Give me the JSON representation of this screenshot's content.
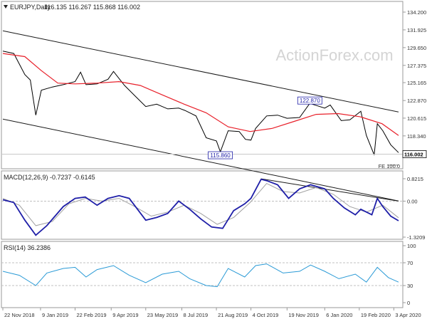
{
  "chart_data": {
    "type": "line",
    "panels": [
      {
        "id": "price",
        "header": {
          "symbol": "EURJPY,Daily",
          "ohlc": "116.135 116.267 115.868 116.002"
        },
        "yticks": [
          "134.200",
          "131.925",
          "129.650",
          "127.375",
          "125.165",
          "122.870",
          "120.615",
          "118.340",
          "116.065",
          "113.855"
        ],
        "ylim": [
          113.855,
          134.2
        ],
        "current_price": "116.002",
        "watermark": "ActionForex.com",
        "annotations": [
          {
            "text": "122.870",
            "x": "2019-12-18",
            "y": 122.87
          },
          {
            "text": "115.860",
            "x": "2019-08-26",
            "y": 115.86
          },
          {
            "text": "FE 100.0",
            "x": "2020-03-28",
            "y": 114.5
          }
        ],
        "series": [
          {
            "color": "#000000",
            "points": [
              [
                "2018-11-22",
                129.2
              ],
              [
                "2018-12-06",
                128.9
              ],
              [
                "2018-12-20",
                126.2
              ],
              [
                "2018-12-27",
                125.5
              ],
              [
                "2019-01-03",
                121.0
              ],
              [
                "2019-01-10",
                124.2
              ],
              [
                "2019-01-24",
                124.6
              ],
              [
                "2019-02-07",
                124.9
              ],
              [
                "2019-02-22",
                125.3
              ],
              [
                "2019-03-01",
                126.5
              ],
              [
                "2019-03-08",
                124.9
              ],
              [
                "2019-03-22",
                125.0
              ],
              [
                "2019-04-05",
                125.6
              ],
              [
                "2019-04-12",
                126.6
              ],
              [
                "2019-04-26",
                124.8
              ],
              [
                "2019-05-10",
                123.4
              ],
              [
                "2019-05-23",
                122.1
              ],
              [
                "2019-06-06",
                122.4
              ],
              [
                "2019-06-20",
                121.8
              ],
              [
                "2019-07-04",
                121.9
              ],
              [
                "2019-07-12",
                121.6
              ],
              [
                "2019-07-26",
                120.9
              ],
              [
                "2019-08-08",
                118.1
              ],
              [
                "2019-08-21",
                117.7
              ],
              [
                "2019-08-26",
                116.3
              ],
              [
                "2019-09-05",
                119.0
              ],
              [
                "2019-09-19",
                118.9
              ],
              [
                "2019-09-27",
                117.9
              ],
              [
                "2019-10-04",
                117.8
              ],
              [
                "2019-10-10",
                119.3
              ],
              [
                "2019-10-24",
                120.9
              ],
              [
                "2019-11-07",
                121.0
              ],
              [
                "2019-11-19",
                120.6
              ],
              [
                "2019-12-05",
                120.7
              ],
              [
                "2019-12-18",
                122.5
              ],
              [
                "2020-01-06",
                121.9
              ],
              [
                "2020-01-13",
                122.3
              ],
              [
                "2020-01-27",
                120.3
              ],
              [
                "2020-02-07",
                120.4
              ],
              [
                "2020-02-21",
                121.5
              ],
              [
                "2020-02-28",
                118.4
              ],
              [
                "2020-03-09",
                115.9
              ],
              [
                "2020-03-13",
                119.9
              ],
              [
                "2020-03-20",
                119.0
              ],
              [
                "2020-03-30",
                117.2
              ],
              [
                "2020-04-09",
                116.2
              ]
            ]
          },
          {
            "color": "#e8202a",
            "points": [
              [
                "2018-11-22",
                128.9
              ],
              [
                "2018-12-20",
                128.5
              ],
              [
                "2019-01-10",
                126.7
              ],
              [
                "2019-01-31",
                125.1
              ],
              [
                "2019-02-22",
                125.0
              ],
              [
                "2019-03-22",
                125.1
              ],
              [
                "2019-04-19",
                125.3
              ],
              [
                "2019-05-16",
                124.8
              ],
              [
                "2019-06-13",
                123.6
              ],
              [
                "2019-07-11",
                122.4
              ],
              [
                "2019-08-08",
                121.3
              ],
              [
                "2019-09-05",
                119.5
              ],
              [
                "2019-10-03",
                118.9
              ],
              [
                "2019-10-31",
                119.3
              ],
              [
                "2019-11-28",
                120.2
              ],
              [
                "2019-12-26",
                121.1
              ],
              [
                "2020-01-23",
                121.2
              ],
              [
                "2020-02-20",
                120.8
              ],
              [
                "2020-03-19",
                119.9
              ],
              [
                "2020-04-09",
                118.4
              ]
            ]
          }
        ],
        "channel_lines": [
          {
            "color": "#1a1a1a",
            "points": [
              [
                "2018-11-22",
                131.8
              ],
              [
                "2020-04-09",
                121.4
              ]
            ]
          },
          {
            "color": "#1a1a1a",
            "points": [
              [
                "2018-11-22",
                120.5
              ],
              [
                "2020-04-09",
                110.0
              ]
            ]
          },
          {
            "color": "#888888",
            "points": [
              [
                "2020-03-26",
                114.6
              ],
              [
                "2020-04-09",
                114.6
              ]
            ]
          }
        ]
      },
      {
        "id": "macd",
        "header": "MACD(12,26,9) -0.7237 -0.6145",
        "yticks": [
          "0.8215",
          "0.00",
          "-1.3209"
        ],
        "ylim": [
          -1.3209,
          0.8215
        ],
        "series": [
          {
            "name": "MACD",
            "color": "#1f1fa8",
            "points": [
              [
                "2018-11-22",
                0.05
              ],
              [
                "2018-12-06",
                -0.05
              ],
              [
                "2018-12-20",
                -0.7
              ],
              [
                "2019-01-03",
                -1.25
              ],
              [
                "2019-01-17",
                -0.9
              ],
              [
                "2019-02-07",
                -0.2
              ],
              [
                "2019-02-22",
                0.1
              ],
              [
                "2019-03-07",
                0.15
              ],
              [
                "2019-03-22",
                -0.15
              ],
              [
                "2019-04-05",
                0.1
              ],
              [
                "2019-04-19",
                0.2
              ],
              [
                "2019-05-02",
                0.1
              ],
              [
                "2019-05-23",
                -0.7
              ],
              [
                "2019-06-06",
                -0.6
              ],
              [
                "2019-06-20",
                -0.45
              ],
              [
                "2019-07-04",
                0.0
              ],
              [
                "2019-07-18",
                -0.3
              ],
              [
                "2019-08-01",
                -0.65
              ],
              [
                "2019-08-15",
                -0.95
              ],
              [
                "2019-08-29",
                -1.0
              ],
              [
                "2019-09-12",
                -0.35
              ],
              [
                "2019-09-26",
                -0.1
              ],
              [
                "2019-10-04",
                0.1
              ],
              [
                "2019-10-17",
                0.8
              ],
              [
                "2019-10-24",
                0.75
              ],
              [
                "2019-11-07",
                0.6
              ],
              [
                "2019-11-21",
                0.1
              ],
              [
                "2019-12-05",
                0.45
              ],
              [
                "2019-12-19",
                0.6
              ],
              [
                "2020-01-06",
                0.45
              ],
              [
                "2020-01-17",
                0.1
              ],
              [
                "2020-01-31",
                -0.25
              ],
              [
                "2020-02-14",
                -0.5
              ],
              [
                "2020-02-21",
                -0.3
              ],
              [
                "2020-03-06",
                -0.5
              ],
              [
                "2020-03-13",
                0.1
              ],
              [
                "2020-03-20",
                -0.2
              ],
              [
                "2020-03-30",
                -0.55
              ],
              [
                "2020-04-09",
                -0.72
              ]
            ]
          },
          {
            "name": "Signal",
            "color": "#a0a0a0",
            "points": [
              [
                "2018-11-22",
                0.1
              ],
              [
                "2018-12-13",
                -0.15
              ],
              [
                "2019-01-03",
                -0.9
              ],
              [
                "2019-01-24",
                -0.75
              ],
              [
                "2019-02-14",
                -0.1
              ],
              [
                "2019-03-07",
                0.1
              ],
              [
                "2019-03-28",
                0.0
              ],
              [
                "2019-04-19",
                0.1
              ],
              [
                "2019-05-09",
                -0.2
              ],
              [
                "2019-05-30",
                -0.55
              ],
              [
                "2019-06-20",
                -0.4
              ],
              [
                "2019-07-11",
                -0.15
              ],
              [
                "2019-08-01",
                -0.45
              ],
              [
                "2019-08-22",
                -0.85
              ],
              [
                "2019-09-12",
                -0.6
              ],
              [
                "2019-10-03",
                -0.05
              ],
              [
                "2019-10-24",
                0.65
              ],
              [
                "2019-11-14",
                0.35
              ],
              [
                "2019-12-05",
                0.3
              ],
              [
                "2019-12-26",
                0.5
              ],
              [
                "2020-01-17",
                0.25
              ],
              [
                "2020-02-07",
                -0.2
              ],
              [
                "2020-02-28",
                -0.4
              ],
              [
                "2020-03-20",
                -0.15
              ],
              [
                "2020-04-09",
                -0.61
              ]
            ]
          }
        ],
        "trend_line": {
          "color": "#1a1a1a",
          "points": [
            [
              "2019-10-17",
              0.82
            ],
            [
              "2020-04-09",
              0.0
            ]
          ]
        }
      },
      {
        "id": "rsi",
        "header": "RSI(14) 36.2386",
        "yticks": [
          "100",
          "70",
          "30",
          "0"
        ],
        "ylim": [
          0,
          100
        ],
        "levels": [
          70,
          30
        ],
        "series": [
          {
            "name": "RSI",
            "color": "#2a9ad6",
            "points": [
              [
                "2018-11-22",
                55
              ],
              [
                "2018-12-13",
                48
              ],
              [
                "2019-01-03",
                30
              ],
              [
                "2019-01-17",
                52
              ],
              [
                "2019-02-07",
                60
              ],
              [
                "2019-02-22",
                62
              ],
              [
                "2019-03-08",
                45
              ],
              [
                "2019-03-22",
                58
              ],
              [
                "2019-04-12",
                65
              ],
              [
                "2019-05-02",
                48
              ],
              [
                "2019-05-23",
                35
              ],
              [
                "2019-06-13",
                50
              ],
              [
                "2019-07-04",
                55
              ],
              [
                "2019-07-18",
                42
              ],
              [
                "2019-08-08",
                30
              ],
              [
                "2019-08-22",
                28
              ],
              [
                "2019-09-05",
                60
              ],
              [
                "2019-09-26",
                45
              ],
              [
                "2019-10-10",
                65
              ],
              [
                "2019-10-24",
                68
              ],
              [
                "2019-11-14",
                52
              ],
              [
                "2019-12-05",
                55
              ],
              [
                "2019-12-19",
                66
              ],
              [
                "2020-01-06",
                55
              ],
              [
                "2020-01-24",
                42
              ],
              [
                "2020-02-14",
                50
              ],
              [
                "2020-02-28",
                36
              ],
              [
                "2020-03-13",
                62
              ],
              [
                "2020-03-27",
                44
              ],
              [
                "2020-04-09",
                36
              ]
            ]
          }
        ]
      }
    ],
    "x_axis": {
      "range": [
        "2018-11-22",
        "2020-04-09"
      ],
      "ticks": [
        {
          "label": "22 Nov 2018",
          "date": "2018-11-22"
        },
        {
          "label": "9 Jan 2019",
          "date": "2019-01-09"
        },
        {
          "label": "22 Feb 2019",
          "date": "2019-02-22"
        },
        {
          "label": "9 Apr 2019",
          "date": "2019-04-09"
        },
        {
          "label": "23 May 2019",
          "date": "2019-05-23"
        },
        {
          "label": "8 Jul 2019",
          "date": "2019-07-08"
        },
        {
          "label": "21 Aug 2019",
          "date": "2019-08-21"
        },
        {
          "label": "4 Oct 2019",
          "date": "2019-10-04"
        },
        {
          "label": "19 Nov 2019",
          "date": "2019-11-19"
        },
        {
          "label": "6 Jan 2020",
          "date": "2020-01-06"
        },
        {
          "label": "19 Feb 2020",
          "date": "2020-02-19"
        },
        {
          "label": "3 Apr 2020",
          "date": "2020-04-03"
        }
      ]
    }
  }
}
